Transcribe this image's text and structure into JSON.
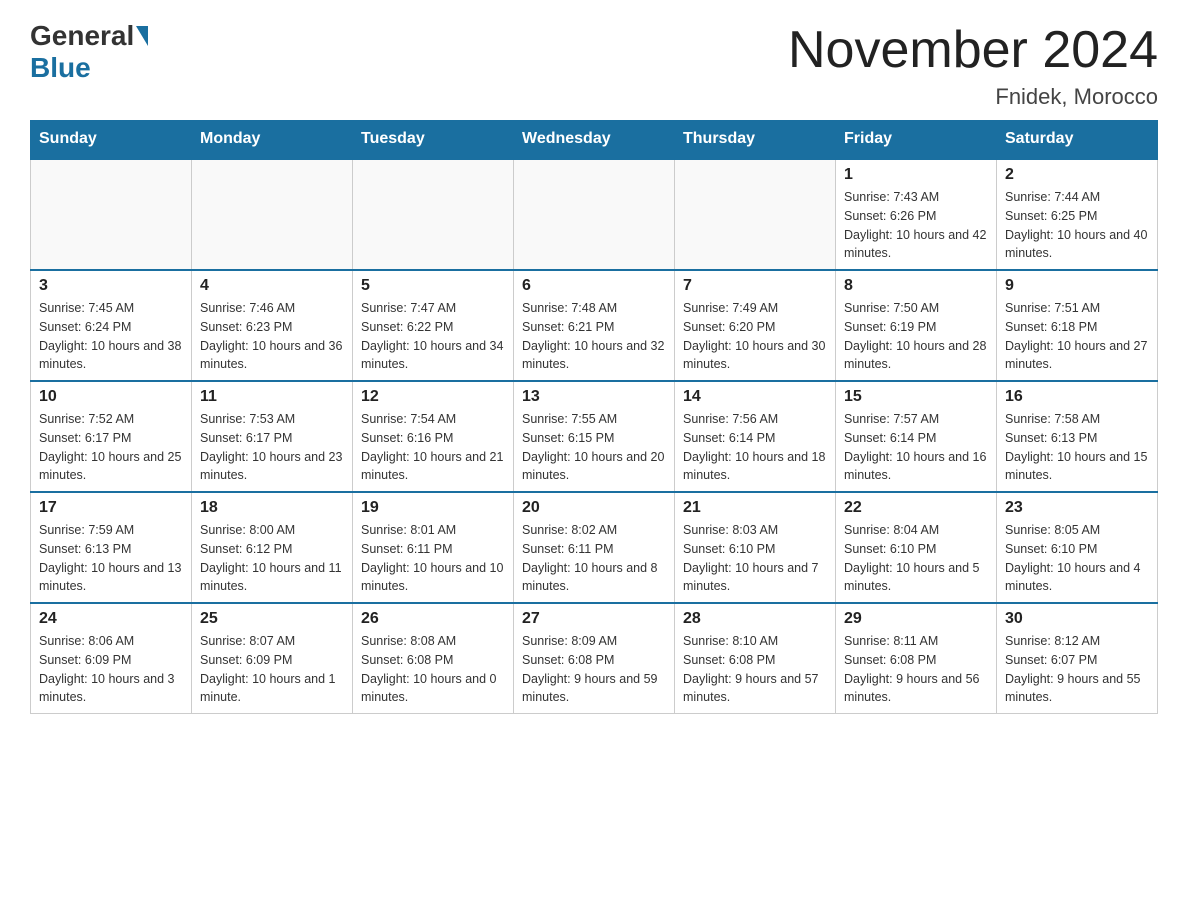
{
  "header": {
    "logo_general": "General",
    "logo_blue": "Blue",
    "month_title": "November 2024",
    "location": "Fnidek, Morocco"
  },
  "days_of_week": [
    "Sunday",
    "Monday",
    "Tuesday",
    "Wednesday",
    "Thursday",
    "Friday",
    "Saturday"
  ],
  "weeks": [
    [
      {
        "day": "",
        "info": ""
      },
      {
        "day": "",
        "info": ""
      },
      {
        "day": "",
        "info": ""
      },
      {
        "day": "",
        "info": ""
      },
      {
        "day": "",
        "info": ""
      },
      {
        "day": "1",
        "info": "Sunrise: 7:43 AM\nSunset: 6:26 PM\nDaylight: 10 hours and 42 minutes."
      },
      {
        "day": "2",
        "info": "Sunrise: 7:44 AM\nSunset: 6:25 PM\nDaylight: 10 hours and 40 minutes."
      }
    ],
    [
      {
        "day": "3",
        "info": "Sunrise: 7:45 AM\nSunset: 6:24 PM\nDaylight: 10 hours and 38 minutes."
      },
      {
        "day": "4",
        "info": "Sunrise: 7:46 AM\nSunset: 6:23 PM\nDaylight: 10 hours and 36 minutes."
      },
      {
        "day": "5",
        "info": "Sunrise: 7:47 AM\nSunset: 6:22 PM\nDaylight: 10 hours and 34 minutes."
      },
      {
        "day": "6",
        "info": "Sunrise: 7:48 AM\nSunset: 6:21 PM\nDaylight: 10 hours and 32 minutes."
      },
      {
        "day": "7",
        "info": "Sunrise: 7:49 AM\nSunset: 6:20 PM\nDaylight: 10 hours and 30 minutes."
      },
      {
        "day": "8",
        "info": "Sunrise: 7:50 AM\nSunset: 6:19 PM\nDaylight: 10 hours and 28 minutes."
      },
      {
        "day": "9",
        "info": "Sunrise: 7:51 AM\nSunset: 6:18 PM\nDaylight: 10 hours and 27 minutes."
      }
    ],
    [
      {
        "day": "10",
        "info": "Sunrise: 7:52 AM\nSunset: 6:17 PM\nDaylight: 10 hours and 25 minutes."
      },
      {
        "day": "11",
        "info": "Sunrise: 7:53 AM\nSunset: 6:17 PM\nDaylight: 10 hours and 23 minutes."
      },
      {
        "day": "12",
        "info": "Sunrise: 7:54 AM\nSunset: 6:16 PM\nDaylight: 10 hours and 21 minutes."
      },
      {
        "day": "13",
        "info": "Sunrise: 7:55 AM\nSunset: 6:15 PM\nDaylight: 10 hours and 20 minutes."
      },
      {
        "day": "14",
        "info": "Sunrise: 7:56 AM\nSunset: 6:14 PM\nDaylight: 10 hours and 18 minutes."
      },
      {
        "day": "15",
        "info": "Sunrise: 7:57 AM\nSunset: 6:14 PM\nDaylight: 10 hours and 16 minutes."
      },
      {
        "day": "16",
        "info": "Sunrise: 7:58 AM\nSunset: 6:13 PM\nDaylight: 10 hours and 15 minutes."
      }
    ],
    [
      {
        "day": "17",
        "info": "Sunrise: 7:59 AM\nSunset: 6:13 PM\nDaylight: 10 hours and 13 minutes."
      },
      {
        "day": "18",
        "info": "Sunrise: 8:00 AM\nSunset: 6:12 PM\nDaylight: 10 hours and 11 minutes."
      },
      {
        "day": "19",
        "info": "Sunrise: 8:01 AM\nSunset: 6:11 PM\nDaylight: 10 hours and 10 minutes."
      },
      {
        "day": "20",
        "info": "Sunrise: 8:02 AM\nSunset: 6:11 PM\nDaylight: 10 hours and 8 minutes."
      },
      {
        "day": "21",
        "info": "Sunrise: 8:03 AM\nSunset: 6:10 PM\nDaylight: 10 hours and 7 minutes."
      },
      {
        "day": "22",
        "info": "Sunrise: 8:04 AM\nSunset: 6:10 PM\nDaylight: 10 hours and 5 minutes."
      },
      {
        "day": "23",
        "info": "Sunrise: 8:05 AM\nSunset: 6:10 PM\nDaylight: 10 hours and 4 minutes."
      }
    ],
    [
      {
        "day": "24",
        "info": "Sunrise: 8:06 AM\nSunset: 6:09 PM\nDaylight: 10 hours and 3 minutes."
      },
      {
        "day": "25",
        "info": "Sunrise: 8:07 AM\nSunset: 6:09 PM\nDaylight: 10 hours and 1 minute."
      },
      {
        "day": "26",
        "info": "Sunrise: 8:08 AM\nSunset: 6:08 PM\nDaylight: 10 hours and 0 minutes."
      },
      {
        "day": "27",
        "info": "Sunrise: 8:09 AM\nSunset: 6:08 PM\nDaylight: 9 hours and 59 minutes."
      },
      {
        "day": "28",
        "info": "Sunrise: 8:10 AM\nSunset: 6:08 PM\nDaylight: 9 hours and 57 minutes."
      },
      {
        "day": "29",
        "info": "Sunrise: 8:11 AM\nSunset: 6:08 PM\nDaylight: 9 hours and 56 minutes."
      },
      {
        "day": "30",
        "info": "Sunrise: 8:12 AM\nSunset: 6:07 PM\nDaylight: 9 hours and 55 minutes."
      }
    ]
  ]
}
